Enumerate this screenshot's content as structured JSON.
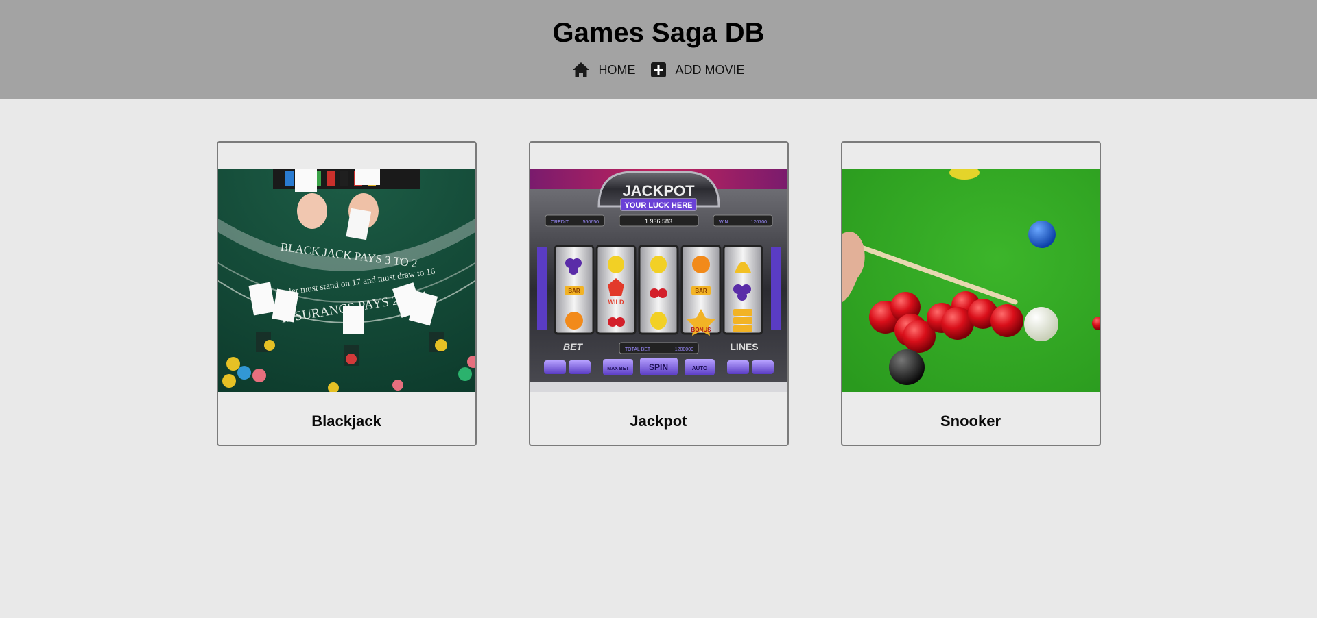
{
  "header": {
    "title": "Games Saga DB",
    "nav": [
      {
        "label": "HOME",
        "icon": "home-icon"
      },
      {
        "label": "ADD MOVIE",
        "icon": "plus-square-icon"
      }
    ]
  },
  "games": [
    {
      "title": "Blackjack",
      "image": "blackjack-table-image"
    },
    {
      "title": "Jackpot",
      "image": "slot-machine-image"
    },
    {
      "title": "Snooker",
      "image": "snooker-table-image"
    }
  ],
  "images": {
    "blackjack": {
      "line1": "BLACK JACK PAYS 3 TO 2",
      "line2": "Dealer must stand on 17 and must draw to 16",
      "line3": "INSURANCE PAYS 2 TO 1"
    },
    "slot": {
      "title": "JACKPOT",
      "subtitle": "YOUR LUCK HERE",
      "credit_label": "CREDIT",
      "credit_value": "560650",
      "center_value": "1.936.583",
      "win_label": "WIN",
      "win_value": "120700",
      "bet_label": "BET",
      "lines_label": "LINES",
      "total_bet_label": "TOTAL BET",
      "total_bet_value": "1200000",
      "max_bet_label": "MAX BET",
      "spin_label": "SPIN",
      "auto_label": "AUTO",
      "bar_label": "BAR",
      "wild_label": "WILD",
      "bonus_label": "BONUS"
    }
  }
}
